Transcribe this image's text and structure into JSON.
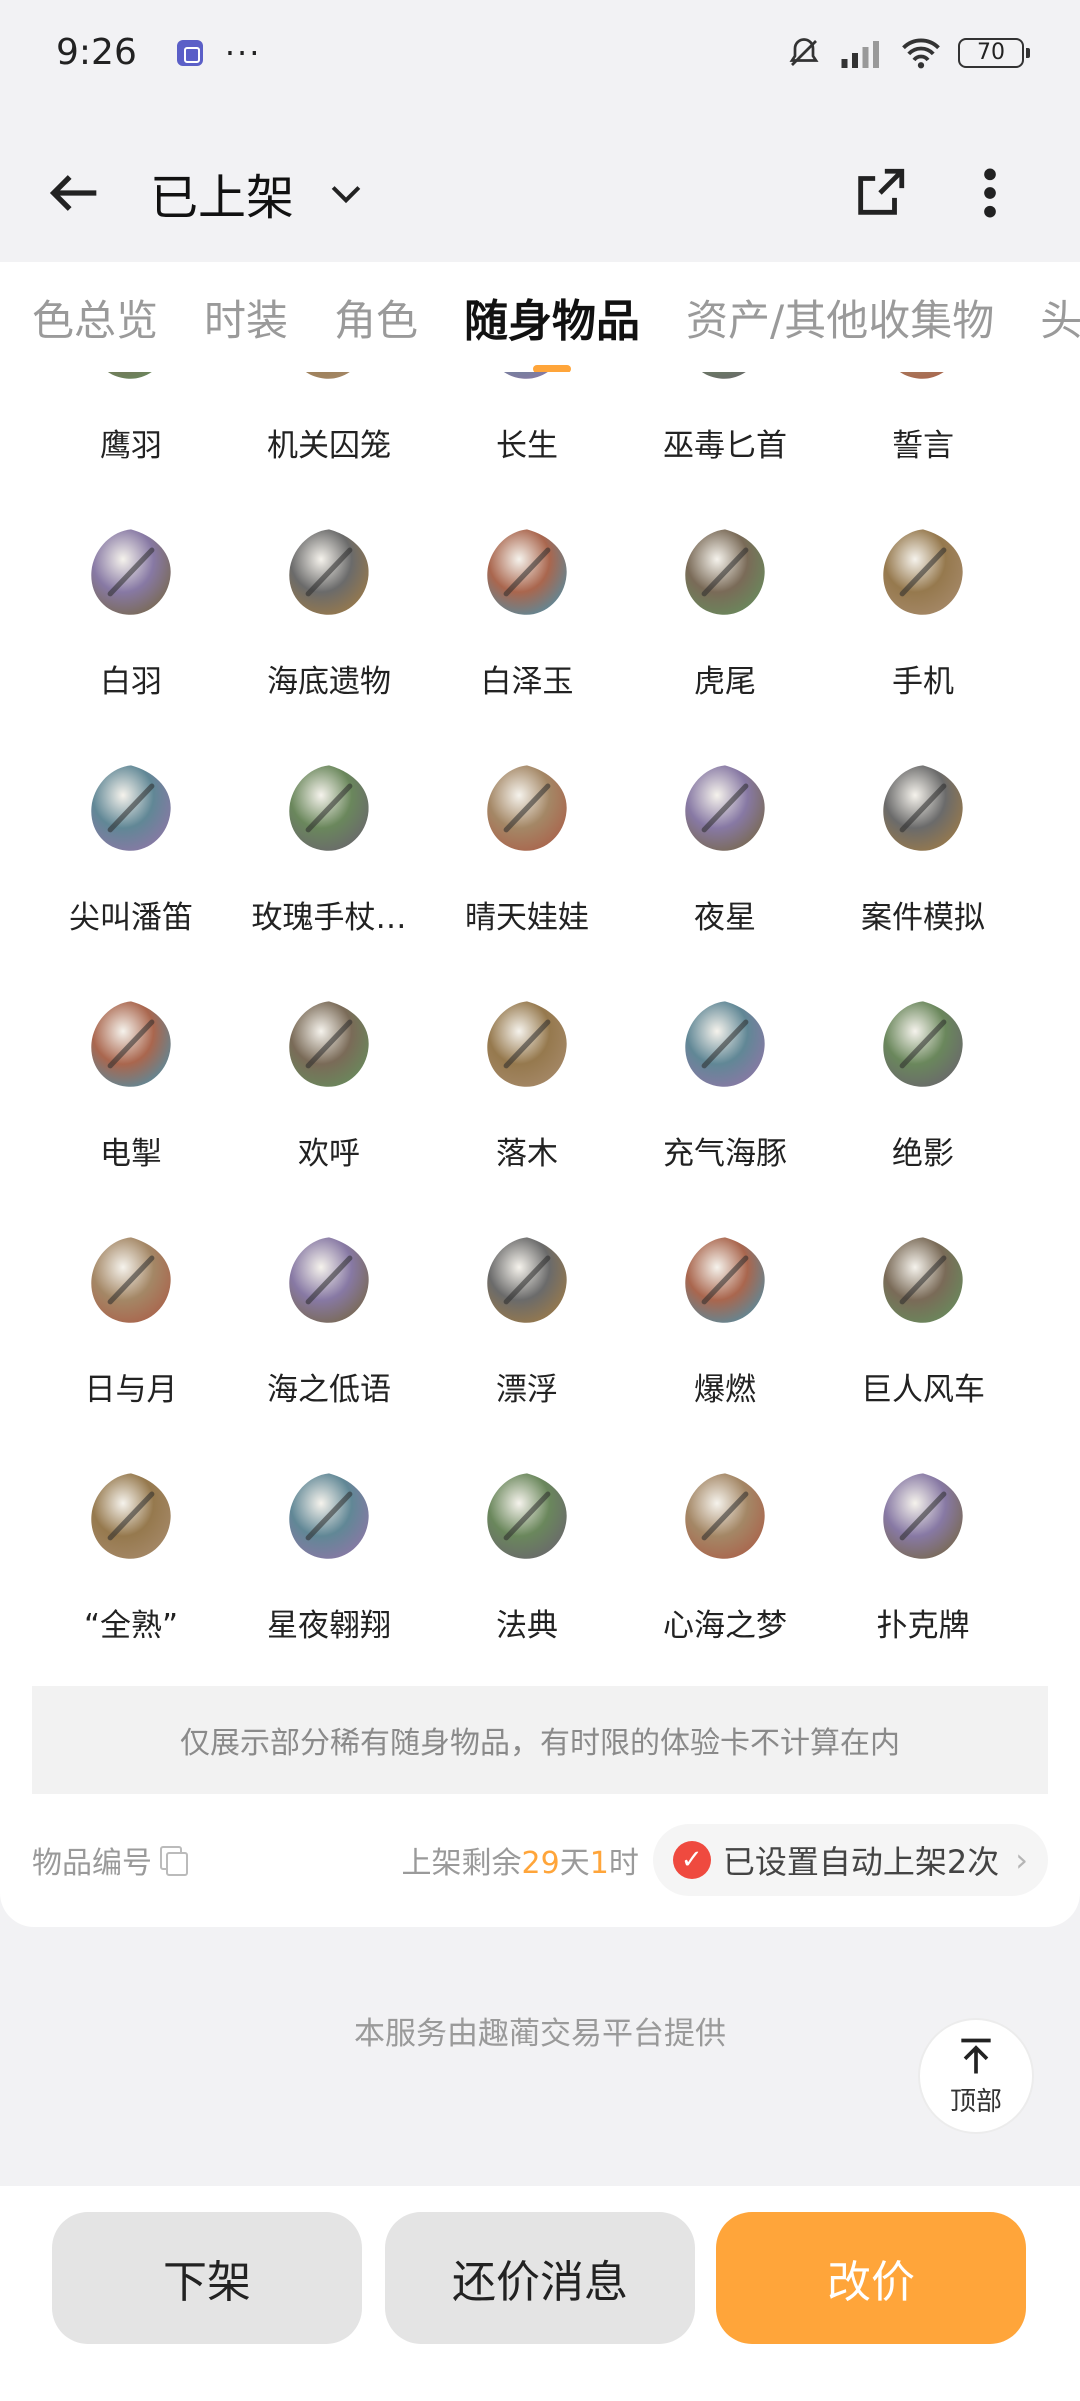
{
  "status_bar": {
    "time": "9:26",
    "dots": "···",
    "battery": "70"
  },
  "header": {
    "title": "已上架"
  },
  "tabs": [
    "色总览",
    "时装",
    "角色",
    "随身物品",
    "资产/其他收集物",
    "头"
  ],
  "active_tab_index": 3,
  "items": [
    {
      "name": "鹰羽",
      "icon": "feather-wing-icon"
    },
    {
      "name": "机关囚笼",
      "icon": "cage-icon"
    },
    {
      "name": "长生",
      "icon": "staff-icon"
    },
    {
      "name": "巫毒匕首",
      "icon": "dagger-icon"
    },
    {
      "name": "誓言",
      "icon": "bell-icon"
    },
    {
      "name": "白羽",
      "icon": "white-feather-icon"
    },
    {
      "name": "海底遗物",
      "icon": "ship-wheel-icon"
    },
    {
      "name": "白泽玉",
      "icon": "jade-icon"
    },
    {
      "name": "虎尾",
      "icon": "tiger-tail-icon"
    },
    {
      "name": "手机",
      "icon": "phone-icon"
    },
    {
      "name": "尖叫潘笛",
      "icon": "pan-flute-icon"
    },
    {
      "name": "玫瑰手杖…",
      "icon": "rose-cane-icon"
    },
    {
      "name": "晴天娃娃",
      "icon": "teru-doll-icon"
    },
    {
      "name": "夜星",
      "icon": "star-icon"
    },
    {
      "name": "案件模拟",
      "icon": "case-model-icon"
    },
    {
      "name": "电掣",
      "icon": "lightning-glove-icon"
    },
    {
      "name": "欢呼",
      "icon": "pompom-icon"
    },
    {
      "name": "落木",
      "icon": "leaf-frame-icon"
    },
    {
      "name": "充气海豚",
      "icon": "dolphin-icon"
    },
    {
      "name": "绝影",
      "icon": "shadow-bird-icon"
    },
    {
      "name": "日与月",
      "icon": "sun-moon-key-icon"
    },
    {
      "name": "海之低语",
      "icon": "shell-guitar-icon"
    },
    {
      "name": "漂浮",
      "icon": "balloon-icon"
    },
    {
      "name": "爆燃",
      "icon": "torch-icon"
    },
    {
      "name": "巨人风车",
      "icon": "windmill-icon"
    },
    {
      "name": "“全熟”",
      "icon": "steak-plate-icon"
    },
    {
      "name": "星夜翱翔",
      "icon": "crystal-bird-icon"
    },
    {
      "name": "法典",
      "icon": "codex-book-icon"
    },
    {
      "name": "心海之梦",
      "icon": "dream-bottle-icon"
    },
    {
      "name": "扑克牌",
      "icon": "poker-cards-icon"
    }
  ],
  "notice": "仅展示部分稀有随身物品，有时限的体验卡不计算在内",
  "info": {
    "item_no_label": "物品编号",
    "remain_prefix": "上架剩余",
    "remain_days": "29",
    "remain_day_unit": "天",
    "remain_hours": "1",
    "remain_hour_unit": "时",
    "auto_list_text": "已设置自动上架2次"
  },
  "footer_note": "本服务由趣蔺交易平台提供",
  "to_top_label": "顶部",
  "bottom_buttons": {
    "unlist": "下架",
    "counter_offer": "还价消息",
    "change_price": "改价"
  },
  "colors": {
    "accent": "#ffa53a",
    "check_red": "#ef4a3f",
    "page_bg": "#f2f2f4"
  }
}
